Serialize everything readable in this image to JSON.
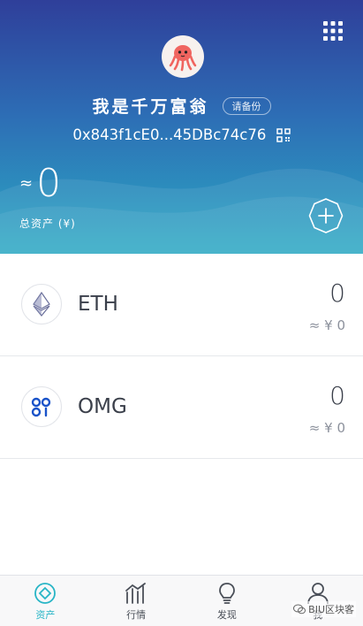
{
  "header": {
    "wallet_name": "我是千万富翁",
    "backup_label": "请备份",
    "address": "0x843f1cE0...45DBc74c76",
    "total_approx": "≈",
    "total_value": "0",
    "total_label": "总资产 (¥)"
  },
  "tokens": [
    {
      "symbol": "ETH",
      "amount": "0",
      "fiat": "≈ ¥ 0",
      "icon": "eth-icon"
    },
    {
      "symbol": "OMG",
      "amount": "0",
      "fiat": "≈ ¥ 0",
      "icon": "omg-icon"
    }
  ],
  "tabbar": {
    "items": [
      {
        "label": "资产",
        "icon": "assets-icon",
        "active": true
      },
      {
        "label": "行情",
        "icon": "market-icon",
        "active": false
      },
      {
        "label": "发现",
        "icon": "discover-icon",
        "active": false
      },
      {
        "label": "我",
        "icon": "profile-icon",
        "active": false
      }
    ]
  },
  "watermark": "BIU区块客",
  "colors": {
    "accent": "#28b5c6",
    "header_top": "#2f3f9a",
    "header_bottom": "#2ca9c4"
  }
}
